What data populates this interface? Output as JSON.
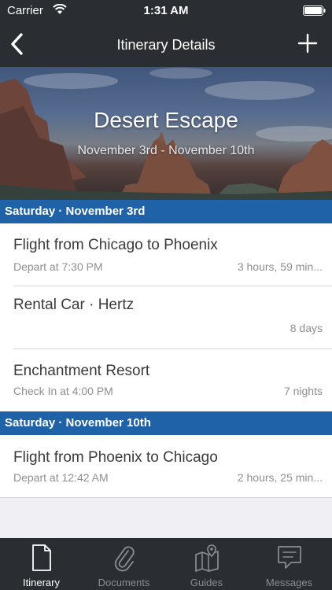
{
  "status_bar": {
    "carrier": "Carrier",
    "time": "1:31 AM"
  },
  "nav": {
    "title": "Itinerary Details"
  },
  "hero": {
    "title": "Desert Escape",
    "dates": "November 3rd - November 10th"
  },
  "sections": [
    {
      "header": "Saturday · November 3rd",
      "items": [
        {
          "title": "Flight from Chicago to Phoenix",
          "detail": "Depart at 7:30 PM",
          "meta": "3 hours, 59 min..."
        },
        {
          "title": "Rental Car · Hertz",
          "detail": "",
          "meta": "8 days"
        },
        {
          "title": "Enchantment Resort",
          "detail": "Check In at 4:00 PM",
          "meta": "7 nights"
        }
      ]
    },
    {
      "header": "Saturday · November 10th",
      "items": [
        {
          "title": "Flight from Phoenix to Chicago",
          "detail": "Depart at 12:42 AM",
          "meta": "2 hours, 25 min..."
        }
      ]
    }
  ],
  "tabs": [
    {
      "label": "Itinerary",
      "icon": "document-icon",
      "active": true
    },
    {
      "label": "Documents",
      "icon": "paperclip-icon",
      "active": false
    },
    {
      "label": "Guides",
      "icon": "map-icon",
      "active": false
    },
    {
      "label": "Messages",
      "icon": "message-icon",
      "active": false
    }
  ],
  "colors": {
    "bar": "#2a2d31",
    "section_header": "#1f62a8",
    "background": "#efeff4"
  }
}
